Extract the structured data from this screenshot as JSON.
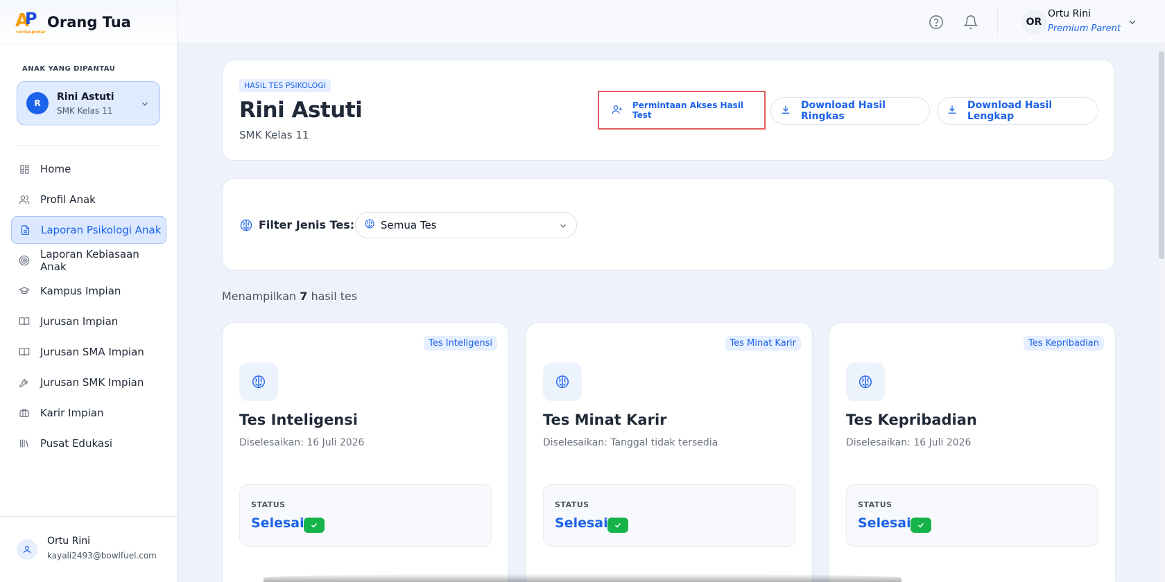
{
  "brand": {
    "title": "Orang Tua",
    "logo_sub": "cerdaspintar"
  },
  "sidebar": {
    "section_label": "ANAK YANG DIPANTAU",
    "child": {
      "initial": "R",
      "name": "Rini Astuti",
      "class": "SMK Kelas 11"
    },
    "items": [
      {
        "label": "Home",
        "icon": "grid-icon"
      },
      {
        "label": "Profil Anak",
        "icon": "users-icon"
      },
      {
        "label": "Laporan Psikologi Anak",
        "icon": "document-icon",
        "active": true
      },
      {
        "label": "Laporan Kebiasaan Anak",
        "icon": "target-icon"
      },
      {
        "label": "Kampus Impian",
        "icon": "graduation-cap-icon"
      },
      {
        "label": "Jurusan Impian",
        "icon": "book-open-icon"
      },
      {
        "label": "Jurusan SMA Impian",
        "icon": "book-open-icon"
      },
      {
        "label": "Jurusan SMK Impian",
        "icon": "wrench-icon"
      },
      {
        "label": "Karir Impian",
        "icon": "briefcase-icon"
      },
      {
        "label": "Pusat Edukasi",
        "icon": "library-icon"
      }
    ],
    "user": {
      "name": "Ortu Rini",
      "email": "kayali2493@bowlfuel.com"
    }
  },
  "topbar": {
    "avatar_initials": "OR",
    "user_name": "Ortu Rini",
    "user_role": "Premium Parent"
  },
  "header": {
    "tag": "HASIL TES PSIKOLOGI",
    "name": "Rini Astuti",
    "class": "SMK Kelas 11",
    "btn_access": "Permintaan Akses Hasil Test",
    "btn_download_short": "Download Hasil Ringkas",
    "btn_download_full": "Download Hasil Lengkap"
  },
  "filter": {
    "label": "Filter Jenis Tes:",
    "selected": "Semua Tes"
  },
  "results": {
    "prefix": "Menampilkan",
    "count": "7",
    "suffix": "hasil tes"
  },
  "cards": [
    {
      "badge": "Tes Inteligensi",
      "title": "Tes Inteligensi",
      "date": "Diselesaikan: 16 Juli 2026",
      "status_label": "STATUS",
      "status": "Selesai"
    },
    {
      "badge": "Tes Minat Karir",
      "title": "Tes Minat Karir",
      "date": "Diselesaikan: Tanggal tidak tersedia",
      "status_label": "STATUS",
      "status": "Selesai"
    },
    {
      "badge": "Tes Kepribadian",
      "title": "Tes Kepribadian",
      "date": "Diselesaikan: 16 Juli 2026",
      "status_label": "STATUS",
      "status": "Selesai"
    }
  ],
  "colors": {
    "accent": "#1d63ea",
    "success": "#16b24a",
    "highlight": "#e35b5b"
  }
}
